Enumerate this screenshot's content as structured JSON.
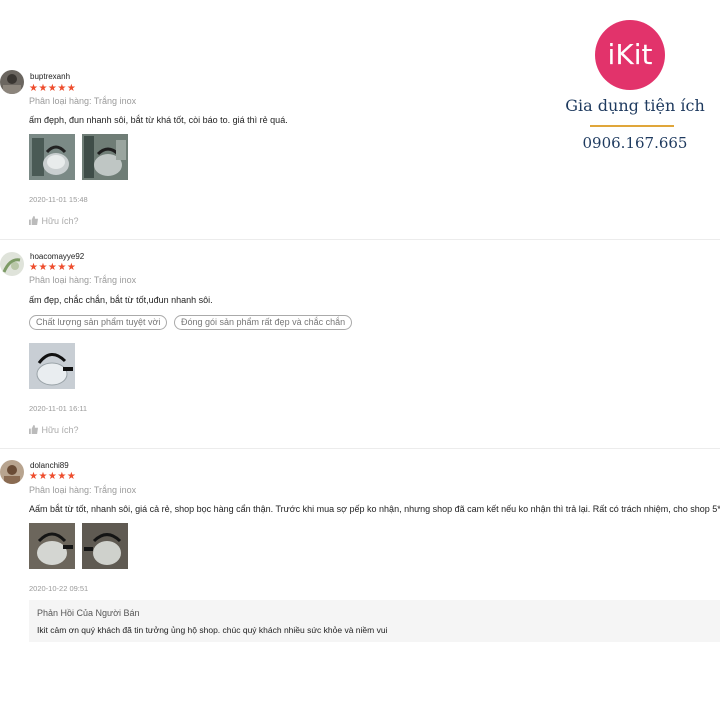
{
  "brand": {
    "logo_text": "iKit",
    "tagline": "Gia dụng tiện ích",
    "phone": "0906.167.665"
  },
  "reviews": [
    {
      "username": "buptrexanh",
      "rating": "★★★★★",
      "variation": "Phân loại hàng: Trắng inox",
      "comment": "ấm đẹph, đun nhanh sôi, bắt từ khá tốt, còi báo to. giá thì rẻ quá.",
      "photo_count": 2,
      "timestamp": "2020-11-01 15:48",
      "helpful_label": "Hữu ích?"
    },
    {
      "username": "hoacomayye92",
      "rating": "★★★★★",
      "variation": "Phân loại hàng: Trắng inox",
      "comment": "ấm đẹp, chắc chắn, bắt từ tốt,uđun nhanh sôi.",
      "tags": [
        "Chất lượng sản phẩm tuyệt vời",
        "Đóng gói sản phẩm rất đẹp và chắc chắn"
      ],
      "photo_count": 1,
      "timestamp": "2020-11-01 16:11",
      "helpful_label": "Hữu ích?"
    },
    {
      "username": "dolanchi89",
      "rating": "★★★★★",
      "variation": "Phân loại hàng: Trắng inox",
      "comment": "Aấm bắt từ tốt, nhanh sôi, giá cả rẻ, shop bọc hàng cẩn thận. Trước khi mua sợ pếp ko nhận, nhưng shop đã cam kết nếu ko nhận thì trả lại. Rất có trách nhiệm, cho shop 5*",
      "photo_count": 2,
      "timestamp": "2020-10-22 09:51",
      "seller_reply": {
        "title": "Phản Hồi Của Người Bán",
        "text": "Ikit cảm ơn quý khách đã tin tưởng ủng hộ shop. chúc quý khách nhiều sức khỏe và niềm vui"
      }
    }
  ],
  "colors": {
    "star": "#ee4d2d",
    "brand_pink": "#e2336b",
    "brand_navy": "#1e3a5f",
    "brand_gold": "#e0a63a"
  }
}
